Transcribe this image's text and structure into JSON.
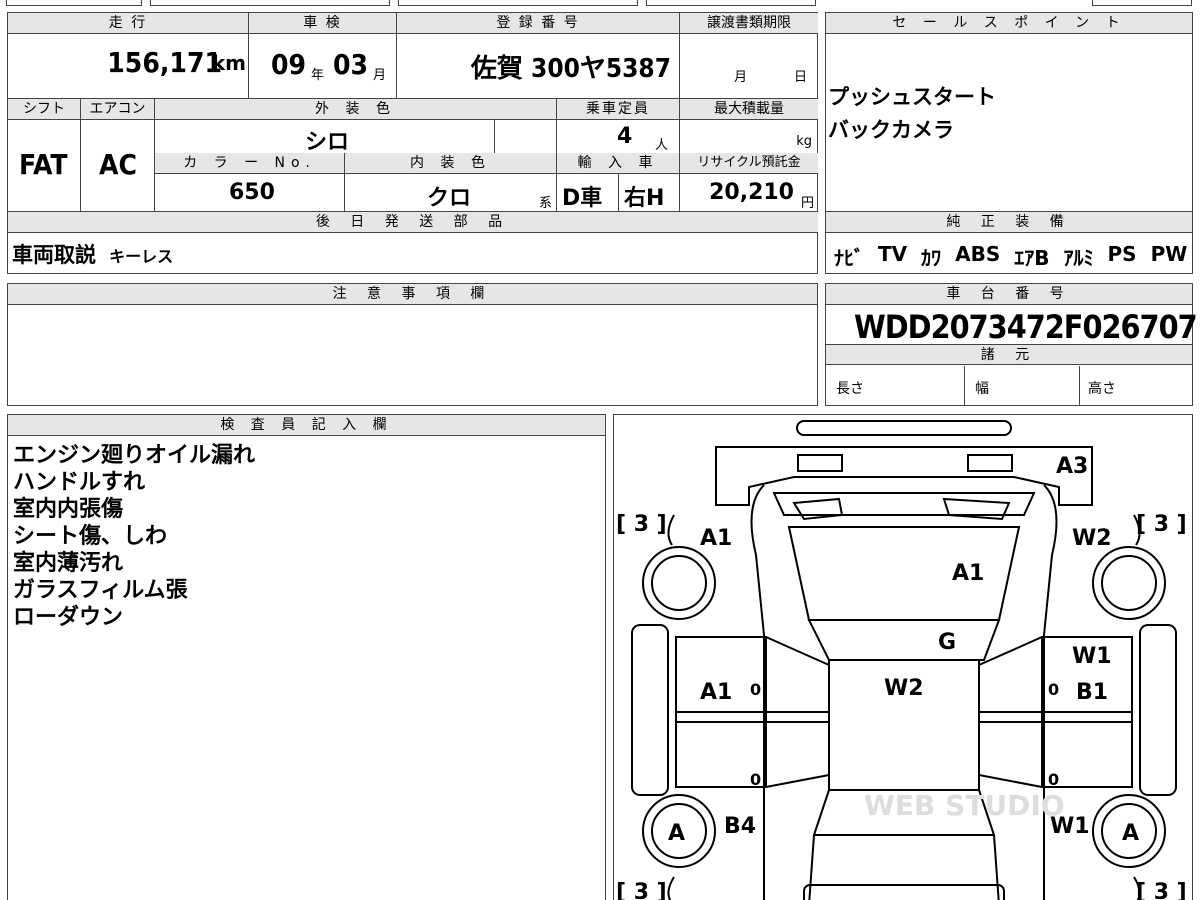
{
  "top": {
    "mileage_label": "走 行",
    "mileage": "156,171",
    "mileage_unit": "km",
    "inspection_label": "車 検",
    "inspection_year": "09",
    "inspection_year_unit": "年",
    "inspection_month": "03",
    "inspection_month_unit": "月",
    "reg_label": "登 録 番 号",
    "reg_value": "佐賀 300ヤ5387",
    "transfer_label": "譲渡書類期限",
    "transfer_month": "月",
    "transfer_day": "日",
    "shift_label": "シフト",
    "shift": "FAT",
    "ac_label": "エアコン",
    "ac": "AC",
    "exterior_label": "外 装 色",
    "exterior": "シロ",
    "capacity_label": "乗車定員",
    "capacity": "4",
    "capacity_unit": "人",
    "maxload_label": "最大積載量",
    "maxload_unit": "kg",
    "colorno_label": "カ ラ ー No.",
    "colorno": "650",
    "interior_label": "内 装 色",
    "interior": "クロ",
    "interior_suffix": "系",
    "import_label": "輸 入 車",
    "import_d": "D車",
    "import_h": "右H",
    "recycle_label": "リサイクル預託金",
    "recycle": "20,210",
    "recycle_unit": "円",
    "later_label": "後 日 発 送 部 品",
    "later_value": "車両取説",
    "later_extra": "キーレス"
  },
  "sales": {
    "label": "セ ー ル ス ポ イ ン ト",
    "lines": [
      "プッシュスタート",
      "バックカメラ"
    ]
  },
  "equip": {
    "label": "純 正 装 備",
    "items": [
      "ﾅﾋﾞ",
      "TV",
      "ｶﾜ",
      "ABS",
      "ｴｱB",
      "ｱﾙﾐ",
      "PS",
      "PW"
    ]
  },
  "notes": {
    "label": "注 意 事 項 欄"
  },
  "chassis": {
    "label": "車 台 番 号",
    "value": "WDD2073472F026707",
    "spec_label": "諸 元",
    "length": "長さ",
    "width": "幅",
    "height": "高さ"
  },
  "inspector": {
    "label": "検 査 員 記 入 欄",
    "lines": [
      "エンジン廻りオイル漏れ",
      "ハンドルすれ",
      "室内内張傷",
      "シート傷、しわ",
      "室内薄汚れ",
      "ガラスフィルム張",
      "ローダウン"
    ]
  },
  "diagram": {
    "marks": [
      "A3",
      "A1",
      "W2",
      "A1",
      "G",
      "W1",
      "W2",
      "A1",
      "B1",
      "B4",
      "W1",
      "A",
      "A"
    ],
    "tire_left_top": "[ 3 ]",
    "tire_right_top": "[ 3 ]",
    "tire_left_bottom": "[ 3 ]",
    "tire_right_bottom": "[ 3 ]",
    "zero": "0",
    "watermark": "WEB STUDIO"
  }
}
